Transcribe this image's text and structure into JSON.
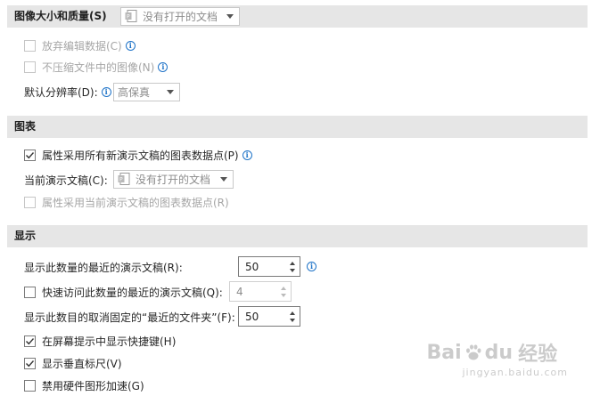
{
  "image_section": {
    "title": "图像大小和质量(S)",
    "doc_dropdown": "没有打开的文档",
    "discard_edit": "放弃编辑数据(C)",
    "no_compress": "不压缩文件中的图像(N)",
    "default_resolution_label": "默认分辨率(D):",
    "default_resolution_value": "高保真"
  },
  "chart_section": {
    "title": "图表",
    "properties_all": "属性采用所有新演示文稿的图表数据点(P)",
    "current_doc_label": "当前演示文稿(C):",
    "current_doc_dropdown": "没有打开的文档",
    "properties_current": "属性采用当前演示文稿的图表数据点(R)"
  },
  "display_section": {
    "title": "显示",
    "recent_docs_label": "显示此数量的最近的演示文稿(R):",
    "recent_docs_value": "50",
    "quick_access_label": "快速访问此数量的最近的演示文稿(Q):",
    "quick_access_value": "4",
    "unpinned_folders_label": "显示此数目的取消固定的“最近的文件夹”(F):",
    "unpinned_folders_value": "50",
    "show_shortcuts": "在屏幕提示中显示快捷键(H)",
    "show_vertical_ruler": "显示垂直标尺(V)",
    "disable_hw_accel": "禁用硬件图形加速(G)"
  },
  "watermark": {
    "brand_a": "Bai",
    "brand_b": "du",
    "brand_cn": "经验",
    "domain": "jingyan.baidu.com"
  },
  "colors": {
    "section_bg": "#e6e6e6",
    "info_blue": "#1e73c8",
    "disabled_text": "#a6a6a6"
  }
}
